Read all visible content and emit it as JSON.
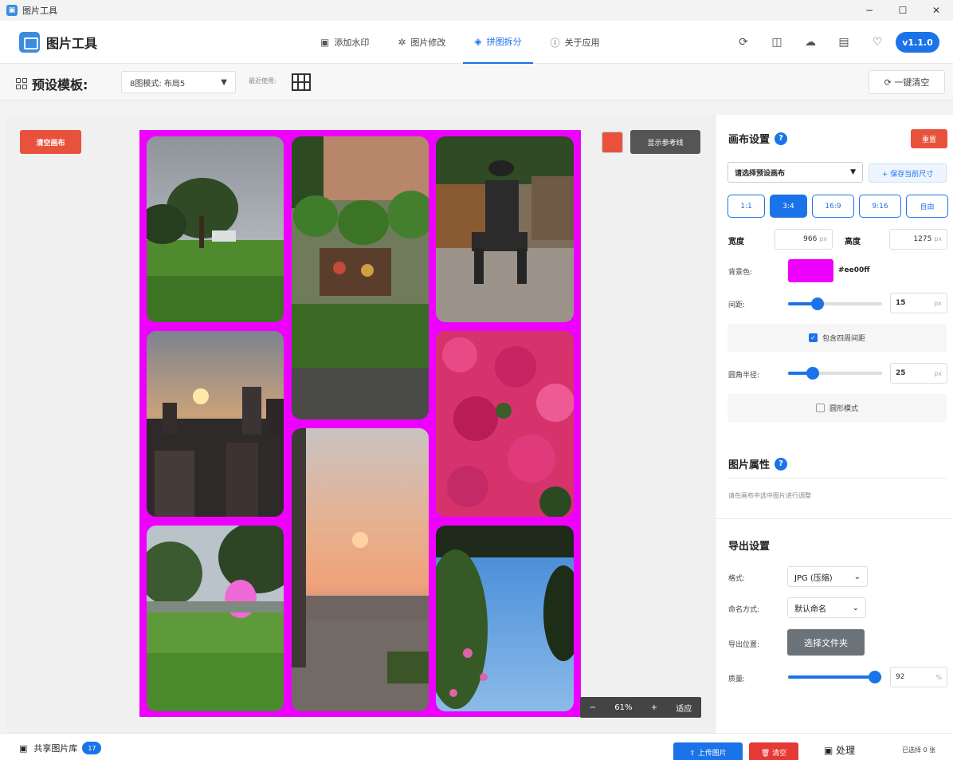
{
  "window": {
    "title": "图片工具",
    "controls": [
      "−",
      "☐",
      "✕"
    ]
  },
  "header": {
    "brand": "图片工具",
    "nav": [
      {
        "label": "添加水印",
        "icon": "watermark-icon",
        "glyph": "▣"
      },
      {
        "label": "图片修改",
        "icon": "gear-icon",
        "glyph": "✲"
      },
      {
        "label": "拼图拆分",
        "icon": "layers-icon",
        "glyph": "◈",
        "active": true
      },
      {
        "label": "关于应用",
        "icon": "info-icon",
        "glyph": "ⓘ"
      }
    ],
    "tools": [
      {
        "icon": "refresh-icon",
        "glyph": "⟳"
      },
      {
        "icon": "book-icon",
        "glyph": "◫"
      },
      {
        "icon": "cloud-icon",
        "glyph": "☁"
      },
      {
        "icon": "file-icon",
        "glyph": "▤"
      },
      {
        "icon": "heart-icon",
        "glyph": "♡"
      }
    ],
    "version": "v1.1.0"
  },
  "toolbar": {
    "preset_label": "预设模板:",
    "preset_value": "8图模式: 布局5",
    "recent_label": "最近使用:",
    "clear_all": "⟳ 一键清空"
  },
  "canvas_area": {
    "clear_canvas": "清空画布",
    "guide_btn": "显示参考线",
    "zoom": {
      "minus": "−",
      "value": "61%",
      "plus": "+",
      "fit": "适应"
    },
    "bg_color": "#ee00ff",
    "guide_color": "#e8523c"
  },
  "panel": {
    "canvas_settings": {
      "title": "画布设置",
      "help": "?",
      "reset": "重置",
      "select_placeholder": "请选择预设画布",
      "save_size": "+ 保存当前尺寸",
      "ratios": [
        "1:1",
        "3:4",
        "16:9",
        "9:16",
        "自由"
      ],
      "active_ratio": "3:4",
      "width_label": "宽度",
      "width_value": "966",
      "height_label": "高度",
      "height_value": "1275",
      "unit_px": "px",
      "bg_label": "背景色:",
      "bg_value": "#ee00ff",
      "gap_label": "间距:",
      "gap_value": "15",
      "gap_fraction": 0.31,
      "include_outer_gap": "包含四周间距",
      "include_outer_gap_checked": true,
      "radius_label": "圆角半径:",
      "radius_value": "25",
      "radius_fraction": 0.26,
      "round_mode": "圆形模式",
      "round_mode_checked": false
    },
    "image_props": {
      "title": "图片属性",
      "help": "?",
      "hint": "请在画布中选中图片进行调整"
    },
    "export": {
      "title": "导出设置",
      "format_label": "格式:",
      "format_value": "JPG (压缩)",
      "naming_label": "命名方式:",
      "naming_value": "默认命名",
      "location_label": "导出位置:",
      "location_btn": "选择文件夹",
      "quality_label": "质量:",
      "quality_value": "92",
      "quality_fraction": 0.92,
      "quality_unit": "%"
    }
  },
  "bottom": {
    "library": "共享图片库",
    "library_count": "17",
    "upload": "⇪ 上传图片",
    "clear": "🗑 清空",
    "process": "▣ 处理",
    "selected": "已选择 0 张"
  }
}
